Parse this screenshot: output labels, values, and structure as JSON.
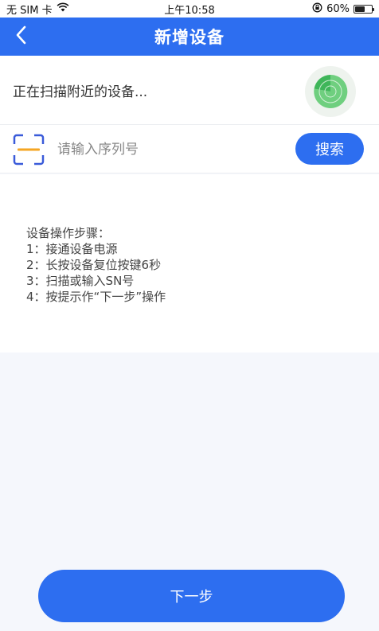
{
  "status_bar": {
    "carrier": "无 SIM 卡",
    "time": "上午10:58",
    "battery": "60%",
    "battery_level": 0.6
  },
  "nav": {
    "title": "新增设备",
    "back_icon": "chevron-left-icon"
  },
  "scan": {
    "status_text": "正在扫描附近的设备...",
    "radar_icon": "radar-icon",
    "radar_color": "#4cc26a"
  },
  "search": {
    "placeholder": "请输入序列号",
    "value": "",
    "button_label": "搜索",
    "scan_icon": "scan-code-icon"
  },
  "steps": {
    "heading": "设备操作步骤：",
    "items": [
      "1：接通设备电源",
      "2：长按设备复位按键6秒",
      "3：扫描或输入SN号",
      "4：按提示作“下一步”操作"
    ]
  },
  "footer": {
    "next_label": "下一步"
  },
  "colors": {
    "primary": "#2d6ef0",
    "accent_orange": "#f5a623",
    "background": "#f5f7fc"
  }
}
